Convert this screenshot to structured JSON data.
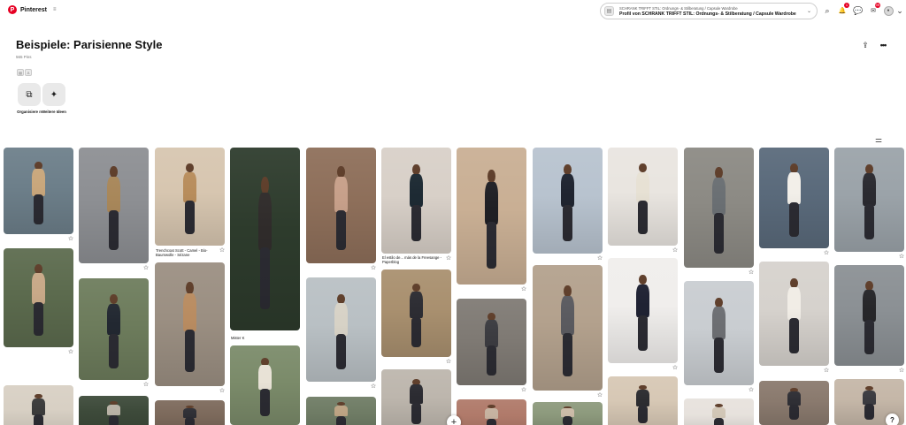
{
  "app": {
    "name": "Pinterest",
    "logo_letter": "P",
    "menu_glyph": "≡"
  },
  "board_select": {
    "line1": "SCHRANK TRIFFT STIL: Ordnungs- & Stilberatung / Capsule Wardrobe",
    "line2": "Profil von SCHRANK TRIFFT STIL: Ordnungs- & Stilberatung / Capsule Wardrobe"
  },
  "top_icons": [
    {
      "name": "search-icon",
      "glyph": "⌕"
    },
    {
      "name": "notifications-icon",
      "glyph": "🔔",
      "badge": "1"
    },
    {
      "name": "messages-icon",
      "glyph": "💬"
    },
    {
      "name": "updates-icon",
      "glyph": "✉",
      "badge": "99"
    },
    {
      "name": "profile-avatar",
      "glyph": "●"
    },
    {
      "name": "account-chevron-icon",
      "glyph": "⌄"
    }
  ],
  "board": {
    "title": "Beispiele: Parisienne Style",
    "pin_count": "565 Pins"
  },
  "actions": [
    {
      "name": "organize-button",
      "icon": "organize-icon",
      "glyph": "⧉",
      "label": "Organisiere n"
    },
    {
      "name": "more-ideas-button",
      "icon": "sparkle-icon",
      "glyph": "✦",
      "label": "Weitere Ideen"
    }
  ],
  "header_icons": {
    "share": "⇪",
    "more": "•••",
    "filter": "⚌"
  },
  "captions": {
    "trenchcoat": "Trenchcoat Scott - Camel - Bio-Baumwolle - Sézane",
    "mister_k": "Mister K",
    "el_estilo": "El estilo de... más de la Freesange - Paperblog"
  },
  "misc": {
    "plus": "+",
    "help": "?",
    "star": "☆"
  },
  "palette": {
    "brand_red": "#e60023",
    "text": "#111111",
    "muted": "#767676",
    "button_bg": "#e9e9e9"
  }
}
